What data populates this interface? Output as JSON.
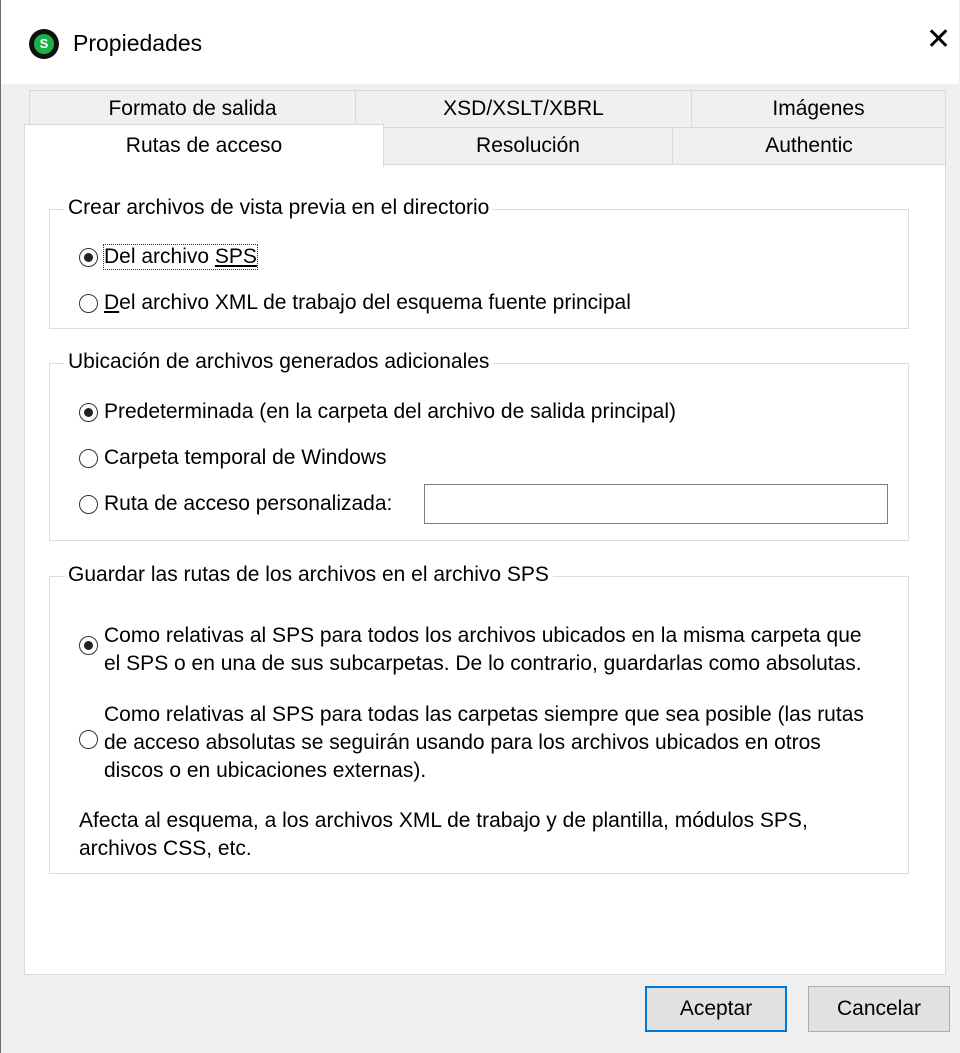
{
  "window": {
    "title": "Propiedades",
    "close_glyph": "✕",
    "app_icon_letter": "S"
  },
  "tabs": {
    "row1": [
      "Formato de salida",
      "XSD/XSLT/XBRL",
      "Imágenes"
    ],
    "row2": [
      "Rutas de acceso",
      "Resolución",
      "Authentic"
    ],
    "active": "Rutas de acceso"
  },
  "preview_group": {
    "legend": "Crear archivos de vista previa en el directorio",
    "opt1_a": "Del archivo ",
    "opt1_b": "SPS",
    "opt2_a": "D",
    "opt2_b": "el archivo XML de trabajo del esquema fuente principal",
    "selected": "opt1"
  },
  "location_group": {
    "legend": "Ubicación de archivos generados adicionales",
    "opt1": "Predeterminada (en la carpeta del archivo de salida principal)",
    "opt2": "Carpeta temporal de Windows",
    "opt3": "Ruta de acceso personalizada:",
    "custom_path_value": "",
    "selected": "opt1"
  },
  "paths_group": {
    "legend": "Guardar las rutas de los archivos en el archivo SPS",
    "opt1_line1": "Como relativas al SPS para todos los archivos ubicados en la misma carpeta que",
    "opt1_line2": "el SPS o en una de sus subcarpetas. De lo contrario, guardarlas como absolutas.",
    "opt2_line1": "Como relativas al SPS para todas las carpetas siempre que sea posible (las rutas",
    "opt2_line2": "de acceso absolutas se seguirán usando para los archivos ubicados en otros",
    "opt2_line3": "discos o en ubicaciones externas).",
    "note_line1": "Afecta al esquema, a los archivos XML de trabajo y de plantilla, módulos SPS,",
    "note_line2": "archivos CSS, etc.",
    "selected": "opt1"
  },
  "buttons": {
    "ok": "Aceptar",
    "cancel": "Cancelar"
  },
  "colors": {
    "accent": "#0078d7",
    "icon_green": "#19b34a"
  }
}
